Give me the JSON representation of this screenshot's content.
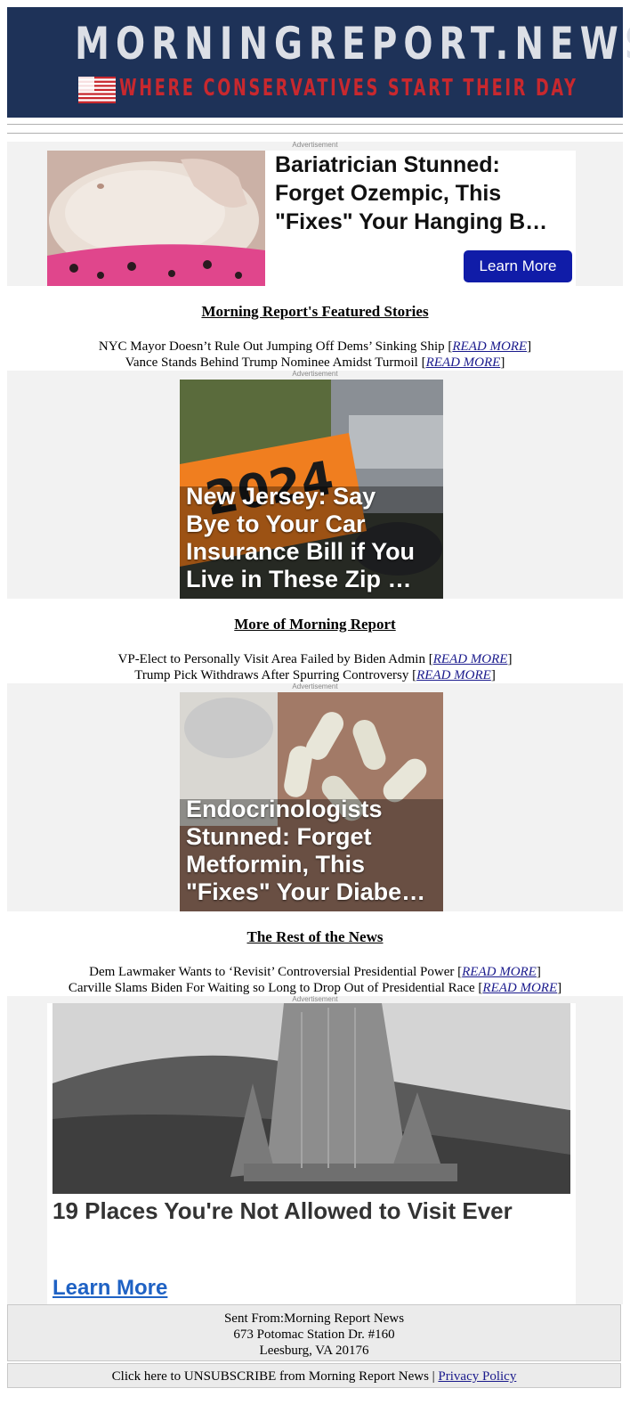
{
  "masthead": {
    "brand": "MORNINGREPORT.NEWS",
    "tagline": "WHERE CONSERVATIVES START THEIR DAY"
  },
  "ad_label": "Advertisement",
  "ad1": {
    "title": "Bariatrician Stunned:\nForget Ozempic, This\n\"Fixes\" Your Hanging B…",
    "button": "Learn More"
  },
  "sections": [
    {
      "title": "Morning Report's Featured Stories",
      "stories": [
        {
          "text": "NYC Mayor Doesn’t Rule Out Jumping Off Dems’ Sinking Ship",
          "link": "READ MORE"
        },
        {
          "text": "Vance Stands Behind Trump Nominee Amidst Turmoil",
          "link": "READ MORE"
        }
      ]
    },
    {
      "title": "More of Morning Report",
      "stories": [
        {
          "text": "VP-Elect to Personally Visit Area Failed by Biden Admin",
          "link": "READ MORE"
        },
        {
          "text": "Trump Pick Withdraws After Spurring Controversy",
          "link": "READ MORE"
        }
      ]
    },
    {
      "title": "The Rest of the News",
      "stories": [
        {
          "text": "Dem Lawmaker Wants to ‘Revisit’ Controversial Presidential Power",
          "link": "READ MORE"
        },
        {
          "text": "Carville Slams Biden For Waiting so Long to Drop Out of Presidential Race",
          "link": "READ MORE"
        }
      ]
    }
  ],
  "ad2": {
    "title": "New Jersey: Say\nBye to Your Car\nInsurance Bill if You\nLive in These Zip …",
    "sticker_text": "2024"
  },
  "ad3": {
    "title": "Endocrinologists\nStunned: Forget\nMetformin, This\n\"Fixes\" Your Diabe…"
  },
  "ad4": {
    "title": "19 Places You're Not Allowed to Visit Ever",
    "link": "Learn More"
  },
  "footer": {
    "line1": "Sent From:Morning Report News",
    "line2": "673 Potomac Station Dr. #160",
    "line3": "Leesburg, VA 20176",
    "unsubscribe": "Click here to UNSUBSCRIBE from Morning Report News",
    "separator": "|",
    "privacy": "Privacy Policy"
  },
  "colors": {
    "masthead_bg": "#1e3258",
    "tagline_red": "#c8282e",
    "button_blue": "#101ca8",
    "link_blue": "#1f62c4"
  }
}
